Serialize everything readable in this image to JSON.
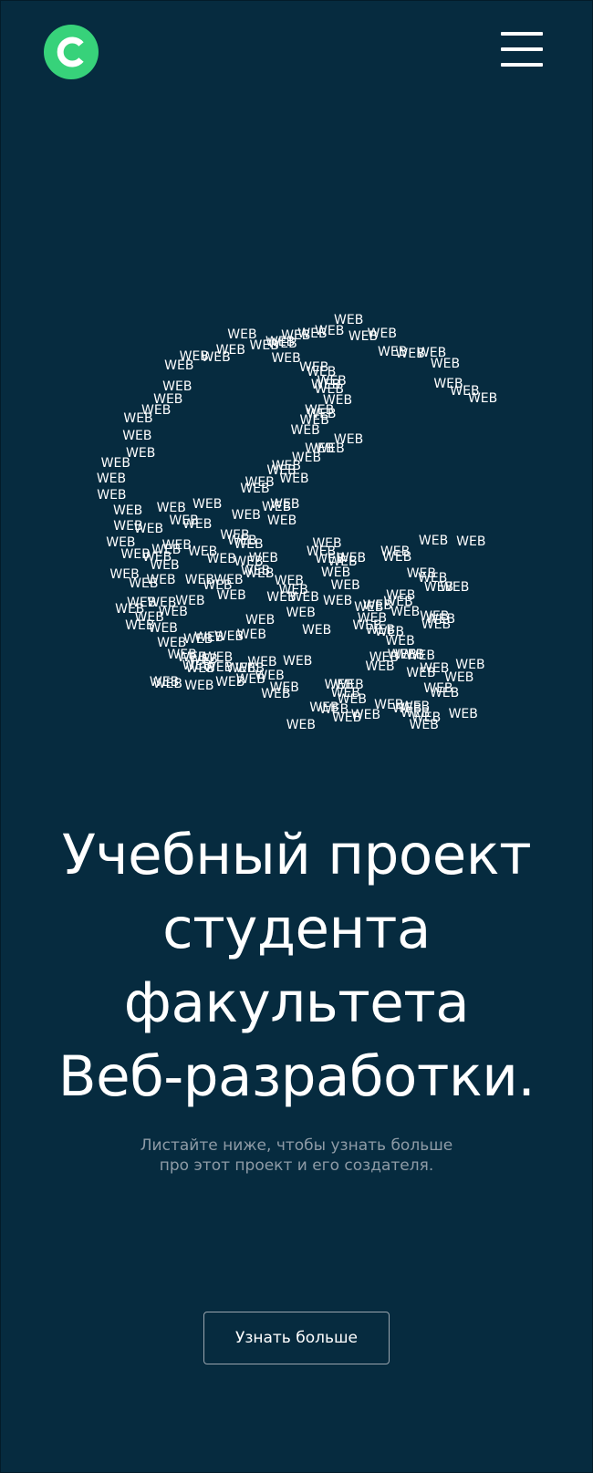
{
  "header": {
    "logo_icon": "logo-c-icon",
    "logo_color": "#37d27a",
    "menu_icon": "hamburger-menu-icon"
  },
  "hero": {
    "art_word": "WEB",
    "title_lines": [
      "Учебный проект",
      "студента",
      "факультета",
      "Веб-разработки."
    ],
    "subtitle_lines": [
      "Листайте ниже, чтобы узнать больше",
      "про этот проект и его создателя."
    ],
    "cta_label": "Узнать больше"
  },
  "colors": {
    "background": "#062b3f",
    "text": "#ffffff",
    "muted_text": "#8e9ba6",
    "accent": "#37d27a"
  }
}
